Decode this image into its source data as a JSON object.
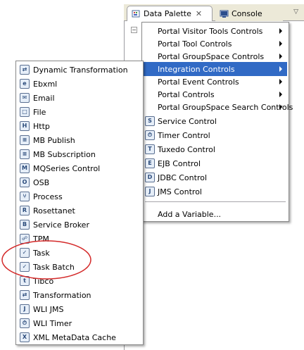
{
  "tabs": [
    {
      "label": "Data Palette",
      "icon": "palette-icon",
      "active": true,
      "close": "✕"
    },
    {
      "label": "Console",
      "icon": "console-icon",
      "active": false
    }
  ],
  "view_menu": "▽",
  "tree_toggle": "−",
  "integration_menu": {
    "submenus": [
      "Portal Visitor Tools Controls",
      "Portal Tool Controls",
      "Portal GroupSpace Controls",
      "Integration Controls",
      "Portal Event Controls",
      "Portal Controls",
      "Portal GroupSpace Search Controls"
    ],
    "highlighted": "Integration Controls",
    "controls": [
      {
        "label": "Service Control",
        "icon": "service-control-icon",
        "glyph": "S"
      },
      {
        "label": "Timer Control",
        "icon": "timer-control-icon",
        "glyph": "⏱"
      },
      {
        "label": "Tuxedo Control",
        "icon": "tuxedo-control-icon",
        "glyph": "T"
      },
      {
        "label": "EJB Control",
        "icon": "ejb-control-icon",
        "glyph": "E"
      },
      {
        "label": "JDBC Control",
        "icon": "jdbc-control-icon",
        "glyph": "D"
      },
      {
        "label": "JMS Control",
        "icon": "jms-control-icon",
        "glyph": "J"
      }
    ],
    "add_variable": "Add a Variable..."
  },
  "controls_menu": {
    "items": [
      {
        "label": "Dynamic Transformation",
        "icon": "dynamic-transformation-icon",
        "glyph": "⇄"
      },
      {
        "label": "Ebxml",
        "icon": "ebxml-icon",
        "glyph": "e"
      },
      {
        "label": "Email",
        "icon": "email-icon",
        "glyph": "✉"
      },
      {
        "label": "File",
        "icon": "file-icon",
        "glyph": "□"
      },
      {
        "label": "Http",
        "icon": "http-icon",
        "glyph": "H"
      },
      {
        "label": "MB Publish",
        "icon": "mb-publish-icon",
        "glyph": "≡"
      },
      {
        "label": "MB Subscription",
        "icon": "mb-subscription-icon",
        "glyph": "≡"
      },
      {
        "label": "MQSeries Control",
        "icon": "mqseries-control-icon",
        "glyph": "M"
      },
      {
        "label": "OSB",
        "icon": "osb-icon",
        "glyph": "O"
      },
      {
        "label": "Process",
        "icon": "process-icon",
        "glyph": "⑂"
      },
      {
        "label": "Rosettanet",
        "icon": "rosettanet-icon",
        "glyph": "R"
      },
      {
        "label": "Service Broker",
        "icon": "service-broker-icon",
        "glyph": "B"
      },
      {
        "label": "TPM",
        "icon": "tpm-icon",
        "glyph": "☍"
      },
      {
        "label": "Task",
        "icon": "task-icon",
        "glyph": "✓"
      },
      {
        "label": "Task Batch",
        "icon": "task-batch-icon",
        "glyph": "✓"
      },
      {
        "label": "Tibco",
        "icon": "tibco-icon",
        "glyph": "t"
      },
      {
        "label": "Transformation",
        "icon": "transformation-icon",
        "glyph": "⇄"
      },
      {
        "label": "WLI JMS",
        "icon": "wli-jms-icon",
        "glyph": "J"
      },
      {
        "label": "WLI Timer",
        "icon": "wli-timer-icon",
        "glyph": "⏱"
      },
      {
        "label": "XML MetaData Cache",
        "icon": "xml-metadata-cache-icon",
        "glyph": "X"
      }
    ]
  },
  "colors": {
    "highlight": "#316ac5",
    "annotation": "#d42a2a",
    "tab_bar": "#ece9d8"
  }
}
